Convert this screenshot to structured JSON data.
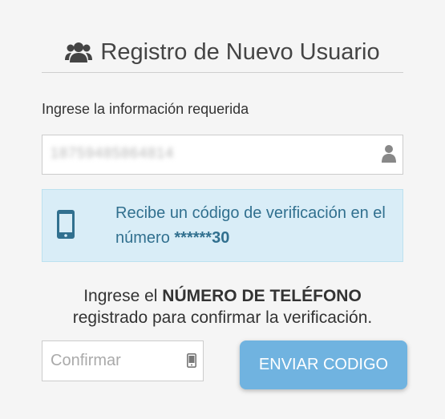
{
  "header": {
    "title": "Registro de Nuevo Usuario",
    "icon": "users-icon"
  },
  "form": {
    "subtitle": "Ingrese la información requerida",
    "user_field": {
      "value": "18759485864814",
      "icon": "user-icon"
    }
  },
  "info": {
    "icon": "mobile-phone-icon",
    "message_prefix": "Recibe un código de verificación en el número",
    "masked_number": "******30"
  },
  "prompt": {
    "prefix": "Ingrese el",
    "emphasis": "NÚMERO DE TELÉFONO",
    "suffix": "registrado para confirmar la verificación."
  },
  "confirm": {
    "placeholder": "Confirmar",
    "icon": "mobile-icon"
  },
  "send_button": {
    "label": "ENVIAR CODIGO"
  },
  "colors": {
    "info_bg": "#d9edf7",
    "info_text": "#31708f",
    "button_bg": "#70b3e0"
  }
}
